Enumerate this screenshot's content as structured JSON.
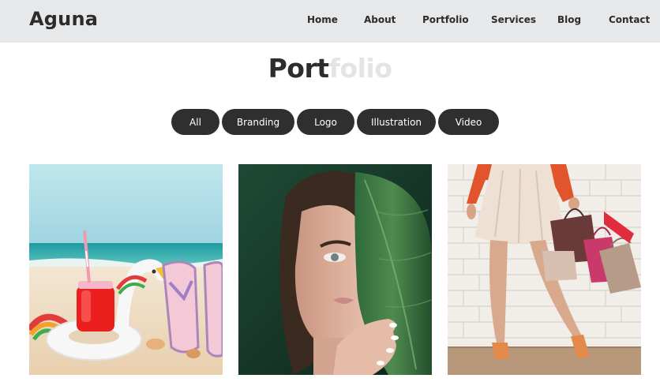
{
  "brand": {
    "name": "Aguna"
  },
  "nav": [
    {
      "label": "Home"
    },
    {
      "label": "About"
    },
    {
      "label": "Portfolio"
    },
    {
      "label": "Services"
    },
    {
      "label": "Blog"
    },
    {
      "label": "Contact"
    }
  ],
  "section": {
    "title_dark": "Port",
    "title_light": "folio"
  },
  "filters": [
    {
      "label": "All"
    },
    {
      "label": "Branding"
    },
    {
      "label": "Logo"
    },
    {
      "label": "Illustration"
    },
    {
      "label": "Video"
    }
  ],
  "colors": {
    "header_bg": "#e7e8ea",
    "button_bg": "#2f2f2f",
    "text_dark": "#2d2d2d",
    "title_light": "#e3e4e6"
  }
}
